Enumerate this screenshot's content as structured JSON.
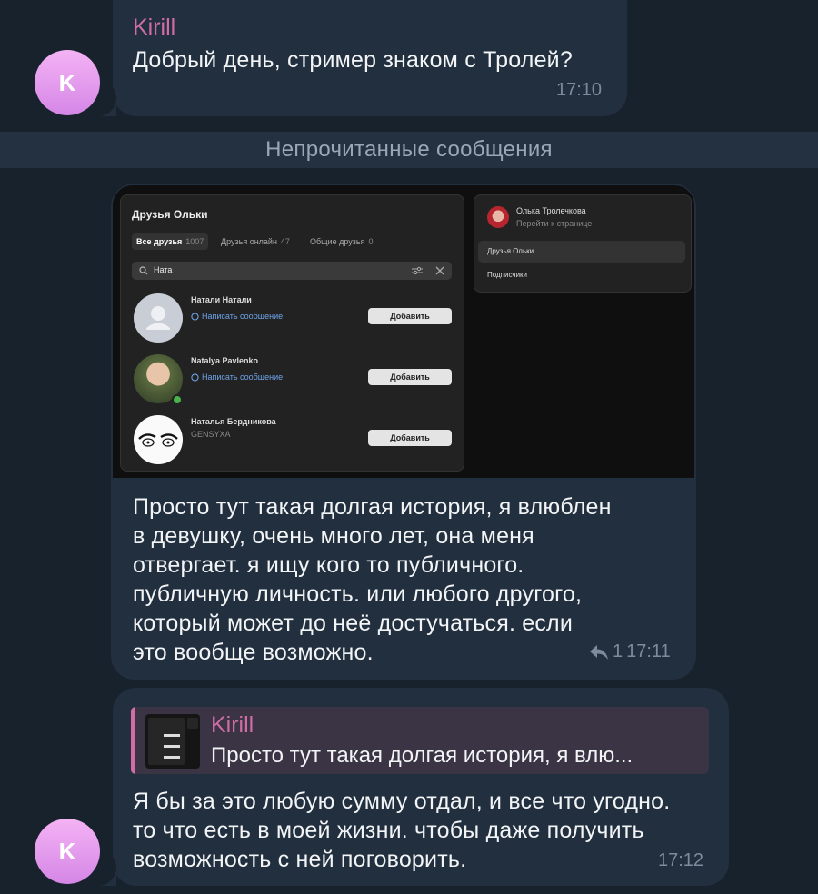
{
  "messages": [
    {
      "sender": "Kirill",
      "avatar_letter": "K",
      "text": "Добрый день, стример знаком с Тролей?",
      "time": "17:10"
    },
    {
      "text_lines": [
        "Просто тут такая долгая история, я влюблен",
        "в девушку, очень много лет, она меня",
        "отвергает. я ищу кого то публичного.",
        "публичную личность. или любого другого,",
        "который может до неё достучаться. если",
        "это вообще возможно."
      ],
      "replies_count": "1",
      "time": "17:11"
    },
    {
      "reply_sender": "Kirill",
      "reply_preview": "Просто тут такая долгая история, я влю...",
      "text_lines": [
        "Я бы за это любую сумму отдал, и все что угодно.",
        "то что есть в моей жизни. чтобы даже получить",
        "возможность с ней поговорить."
      ],
      "avatar_letter": "K",
      "time": "17:12"
    }
  ],
  "unread_divider": "Непрочитанные сообщения",
  "screenshot": {
    "title": "Друзья Ольки",
    "tabs": [
      {
        "label": "Все друзья",
        "count": "1007"
      },
      {
        "label": "Друзья онлайн",
        "count": "47"
      },
      {
        "label": "Общие друзья",
        "count": "0"
      }
    ],
    "search_value": "Ната",
    "friends": [
      {
        "name": "Натали Натали",
        "sub": "Написать сообщение",
        "button": "Добавить"
      },
      {
        "name": "Natalya Pavlenko",
        "sub": "Написать сообщение",
        "button": "Добавить"
      },
      {
        "name": "Наталья Бердникова",
        "sub": "GENSYXA",
        "button": "Добавить"
      }
    ],
    "profile_name": "Олька Тролечкова",
    "profile_link": "Перейти к странице",
    "menu": [
      "Друзья Ольки",
      "Подписчики"
    ]
  },
  "colors": {
    "background": "#18222d",
    "bubble": "#222f3f",
    "sender": "#d06da5",
    "time": "#7d8c9c",
    "avatar": "#e29df0"
  }
}
